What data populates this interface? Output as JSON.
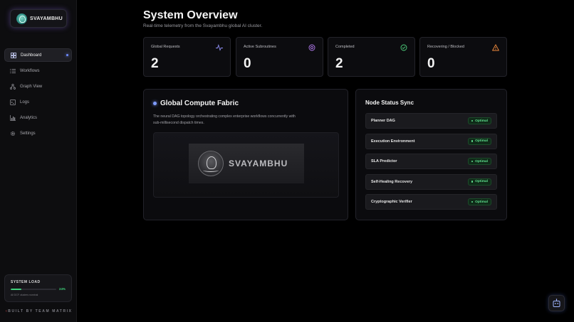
{
  "brand": {
    "name": "SVAYAMBHU"
  },
  "sidebar": {
    "items": [
      {
        "label": "Dashboard",
        "icon": "grid-icon",
        "active": true
      },
      {
        "label": "Workflows",
        "icon": "list-icon",
        "active": false
      },
      {
        "label": "Graph View",
        "icon": "graph-icon",
        "active": false
      },
      {
        "label": "Logs",
        "icon": "terminal-icon",
        "active": false
      },
      {
        "label": "Analytics",
        "icon": "bar-chart-icon",
        "active": false
      },
      {
        "label": "Settings",
        "icon": "gear-icon",
        "active": false
      }
    ],
    "system_load": {
      "title": "SYSTEM LOAD",
      "percent_label": "24%",
      "percent": 24,
      "sub": "All DCF clusters nominal"
    },
    "built_by": "BUILT BY TEAM MATRIX"
  },
  "header": {
    "title": "System Overview",
    "subtitle": "Real-time telemetry from the Svayambhu global AI cluster."
  },
  "stats": [
    {
      "label": "Global Requests",
      "value": "2",
      "icon": "activity-icon",
      "color": "#8f8ff5"
    },
    {
      "label": "Active Subroutines",
      "value": "0",
      "icon": "target-icon",
      "color": "#b57cf2"
    },
    {
      "label": "Completed",
      "value": "2",
      "icon": "check-circle-icon",
      "color": "#4fd37e"
    },
    {
      "label": "Recovering / Blocked",
      "value": "0",
      "icon": "warning-icon",
      "color": "#f08a3c"
    }
  ],
  "fabric": {
    "title": "Global Compute Fabric",
    "description": "The neural DAG topology orchestrating complex enterprise workflows concurrently with sub-millisecond dispatch times.",
    "banner_text": "SVAYAMBHU"
  },
  "node_status": {
    "title": "Node Status Sync",
    "rows": [
      {
        "name": "Planner DAG",
        "status": "Optimal"
      },
      {
        "name": "Execution Environment",
        "status": "Optimal"
      },
      {
        "name": "SLA Predictor",
        "status": "Optimal"
      },
      {
        "name": "Self-Healing Recovery",
        "status": "Optimal"
      },
      {
        "name": "Cryptographic Verifier",
        "status": "Optimal"
      }
    ]
  },
  "colors": {
    "accent": "#6f8cff",
    "success": "#5fe08f"
  }
}
